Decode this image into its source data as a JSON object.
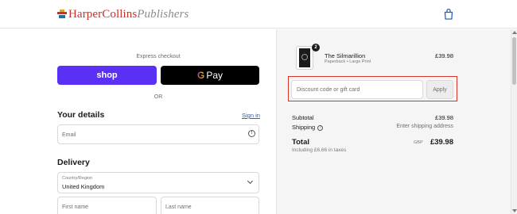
{
  "header": {
    "logo_primary": "HarperCollins",
    "logo_secondary": "Publishers"
  },
  "checkout": {
    "express_label": "Express checkout",
    "shop_label": "shop",
    "gpay_label": "Pay",
    "or_label": "OR"
  },
  "details": {
    "title": "Your details",
    "signin_label": "Sign in",
    "email_placeholder": "Email"
  },
  "delivery": {
    "title": "Delivery",
    "country_label": "Country/Region",
    "country_value": "United Kingdom",
    "first_name_placeholder": "First name",
    "last_name_placeholder": "Last name"
  },
  "cart": {
    "quantity": "2",
    "title": "The Silmarillion",
    "subtitle": "Paperback • Large Print",
    "price": "£39.98"
  },
  "discount": {
    "placeholder": "Discount code or gift card",
    "apply_label": "Apply"
  },
  "summary": {
    "subtotal_label": "Subtotal",
    "subtotal_value": "£39.98",
    "shipping_label": "Shipping",
    "shipping_value": "Enter shipping address",
    "total_label": "Total",
    "currency": "GBP",
    "total_value": "£39.98",
    "tax_note": "Including £6.66 in taxes"
  },
  "colors": {
    "shop_purple": "#5a31f4",
    "highlight_red": "#d9342b",
    "link_blue": "#2b62b5"
  }
}
